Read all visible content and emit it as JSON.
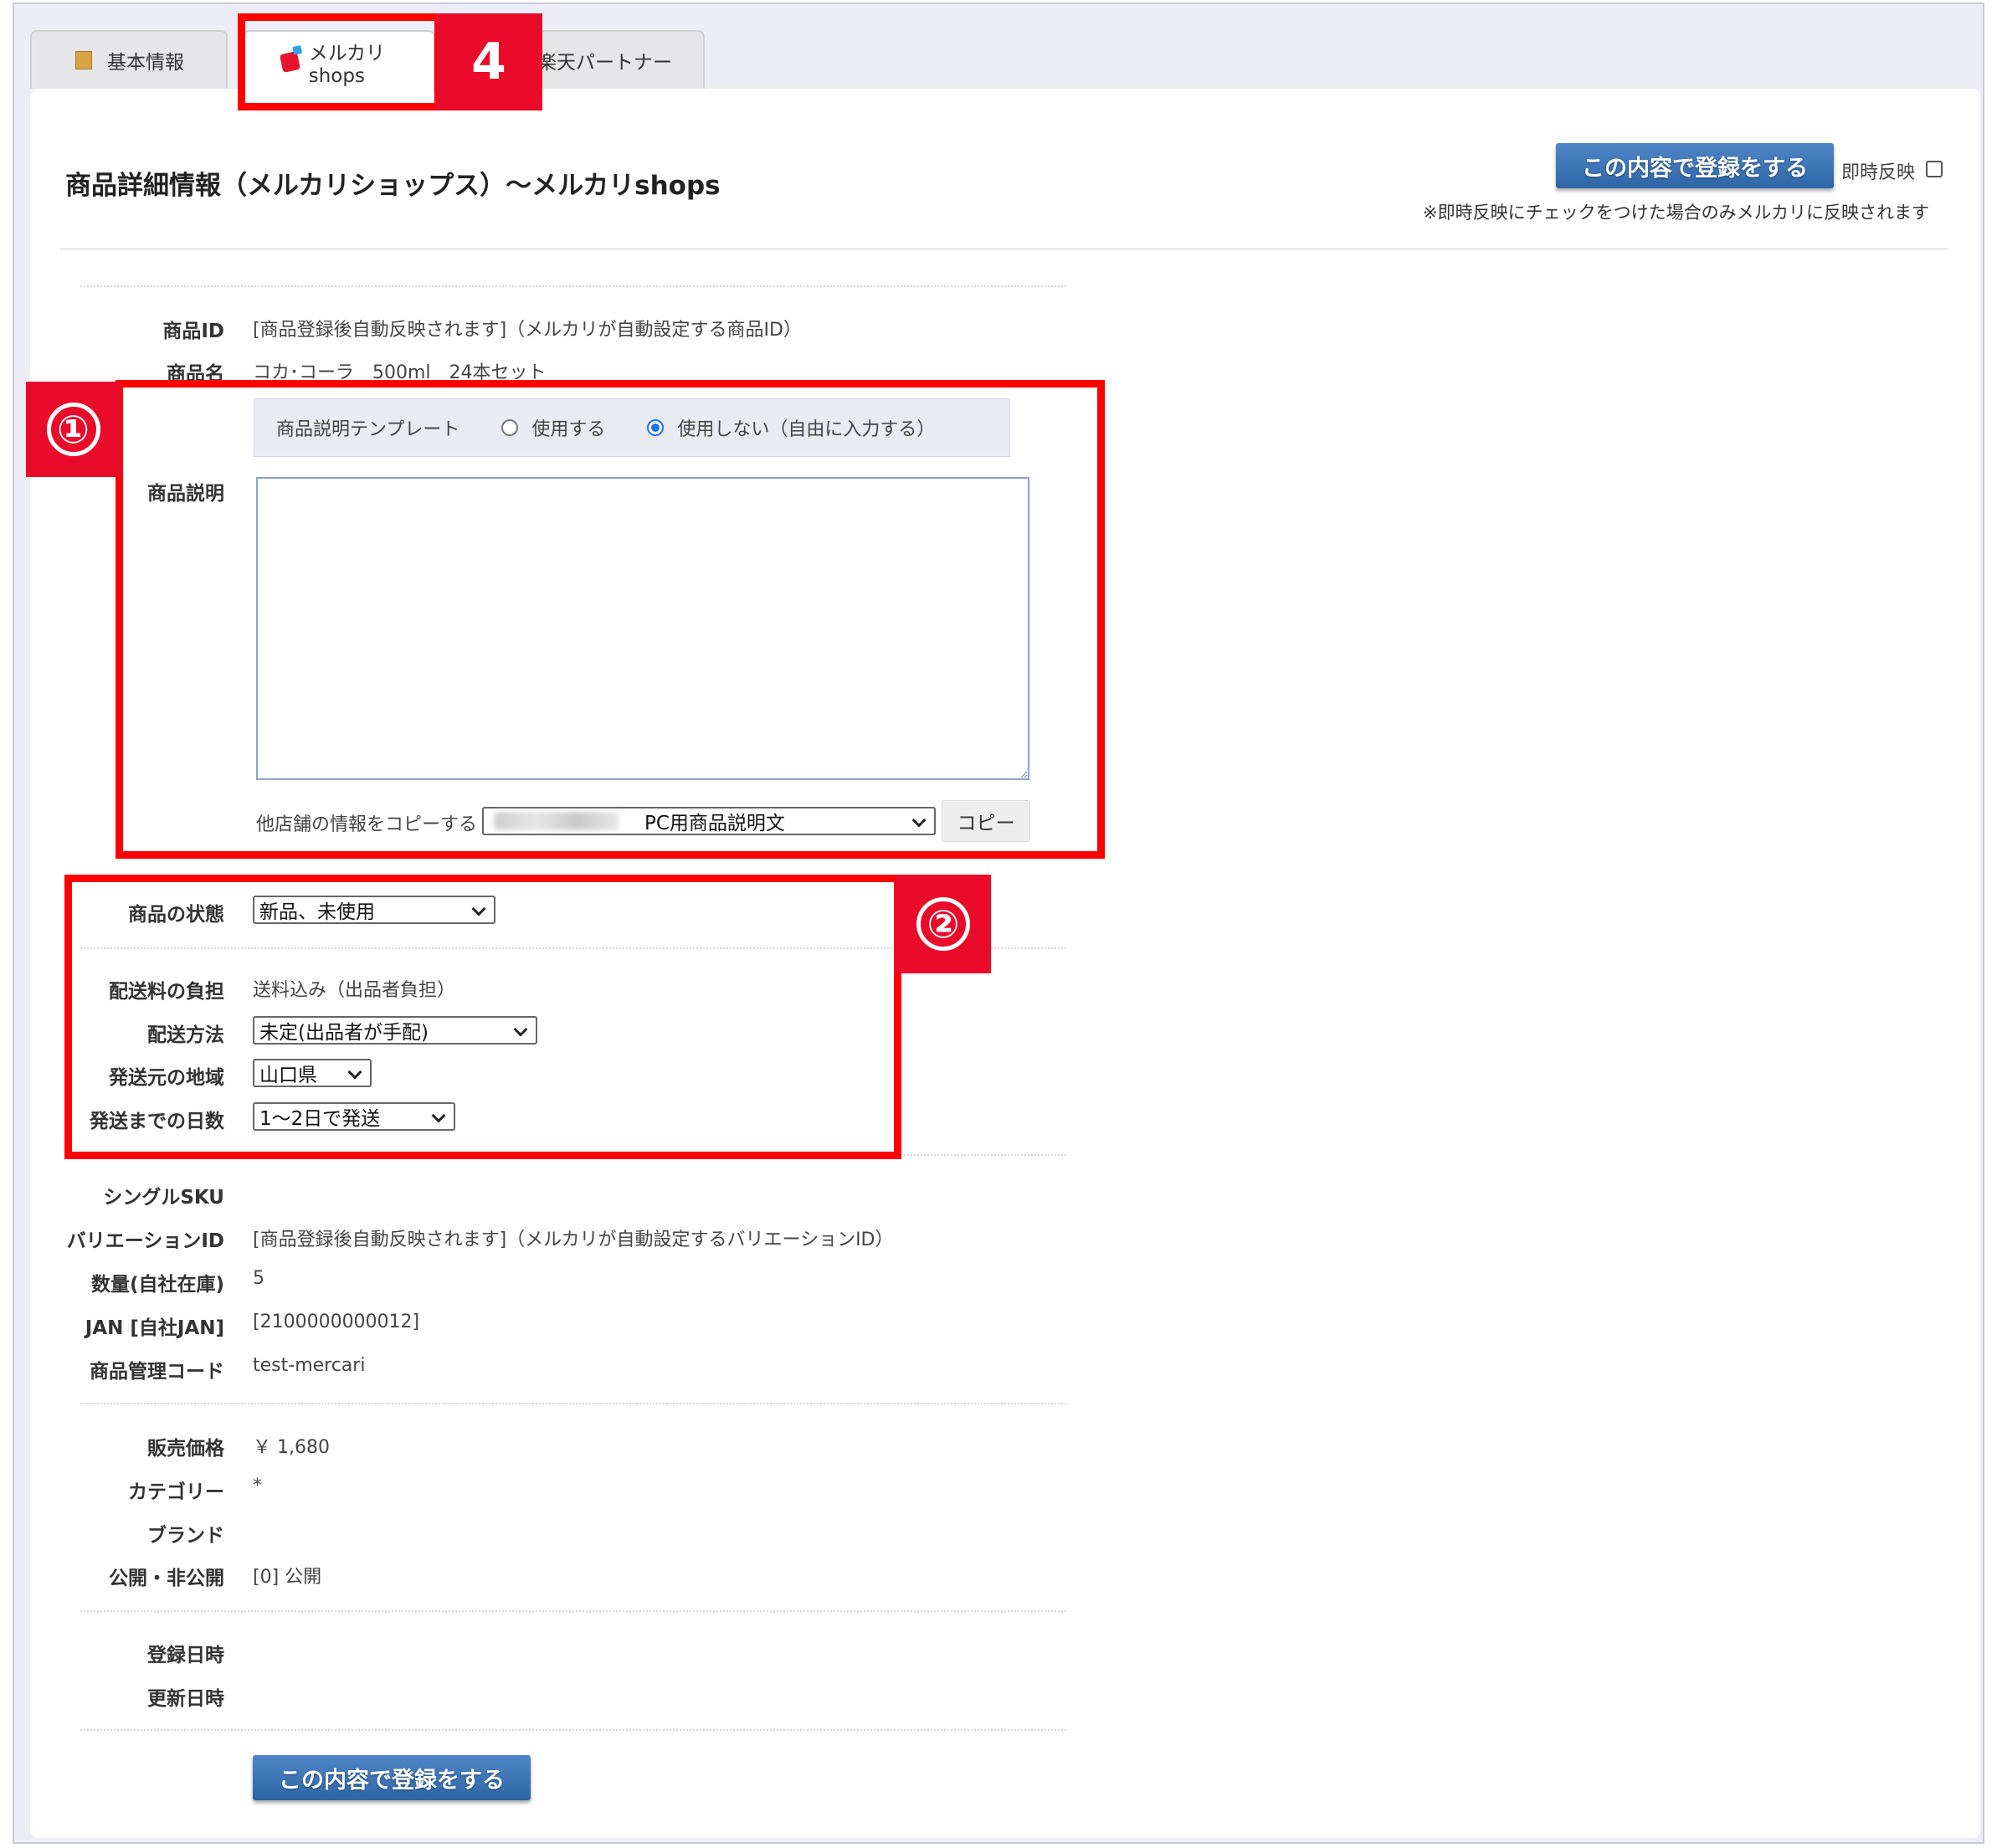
{
  "tabs": {
    "basic": "基本情報",
    "mercari": "メルカリshops",
    "rakuten": "楽天パートナー",
    "marker": "4"
  },
  "header": {
    "title": "商品詳細情報（メルカリショップス）～メルカリshops",
    "register_label": "この内容で登録をする",
    "instant_label": "即時反映",
    "instant_note": "※即時反映にチェックをつけた場合のみメルカリに反映されます"
  },
  "product": {
    "id_label": "商品ID",
    "id_value": "[商品登録後自動反映されます]（メルカリが自動設定する商品ID）",
    "name_label": "商品名",
    "name_value": "コカ･コーラ　500ml　24本セット"
  },
  "description": {
    "marker": "①",
    "label": "商品説明",
    "template_label": "商品説明テンプレート",
    "use_label": "使用する",
    "nouse_label": "使用しない（自由に入力する）",
    "selected": "nouse",
    "textarea_value": "",
    "copy_label": "他店舗の情報をコピーする",
    "copy_select": "PC用商品説明文",
    "copy_button": "コピー"
  },
  "shipping": {
    "marker": "②",
    "condition_label": "商品の状態",
    "condition_value": "新品、未使用",
    "fee_label": "配送料の負担",
    "fee_value": "送料込み（出品者負担）",
    "method_label": "配送方法",
    "method_value": "未定(出品者が手配)",
    "region_label": "発送元の地域",
    "region_value": "山口県",
    "days_label": "発送までの日数",
    "days_value": "1～2日で発送"
  },
  "sku": {
    "single_label": "シングルSKU",
    "variation_label": "バリエーションID",
    "variation_value": "[商品登録後自動反映されます]（メルカリが自動設定するバリエーションID）",
    "qty_label": "数量(自社在庫)",
    "qty_value": "5",
    "jan_label": "JAN [自社JAN]",
    "jan_value": "[2100000000012]",
    "code_label": "商品管理コード",
    "code_value": "test-mercari"
  },
  "sale": {
    "price_label": "販売価格",
    "price_value": "￥ 1,680",
    "category_label": "カテゴリー",
    "category_value": "*",
    "brand_label": "ブランド",
    "public_label": "公開・非公開",
    "public_value": "[0] 公開"
  },
  "dates": {
    "registered_label": "登録日時",
    "updated_label": "更新日時"
  },
  "footer": {
    "register_label": "この内容で登録をする"
  }
}
